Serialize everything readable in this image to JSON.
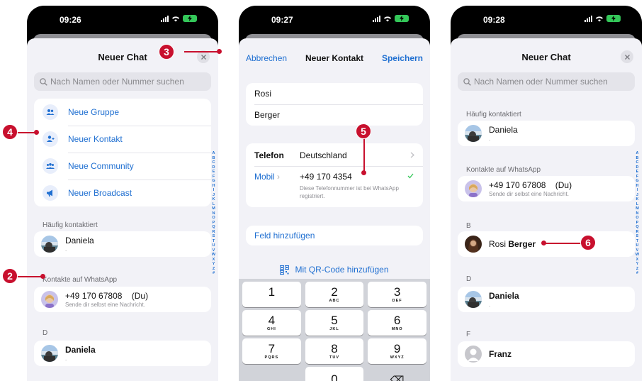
{
  "screen1": {
    "time": "09:26",
    "title": "Neuer Chat",
    "search_placeholder": "Nach Namen oder Nummer suchen",
    "actions": [
      {
        "label": "Neue Gruppe",
        "icon": "group-icon"
      },
      {
        "label": "Neuer Kontakt",
        "icon": "add-contact-icon"
      },
      {
        "label": "Neue Community",
        "icon": "community-icon"
      },
      {
        "label": "Neuer Broadcast",
        "icon": "broadcast-icon"
      }
    ],
    "section_frequent": "Häufig kontaktiert",
    "frequent": [
      {
        "name": "Daniela",
        "sub": "."
      }
    ],
    "section_whatsapp": "Kontakte auf WhatsApp",
    "self_contact": {
      "name": "+49 170 67808",
      "tag": "(Du)",
      "sub": "Sende dir selbst eine Nachricht."
    },
    "section_d": "D",
    "d_contacts": [
      {
        "name": "Daniela",
        "sub": "."
      }
    ]
  },
  "screen2": {
    "time": "09:27",
    "cancel": "Abbrechen",
    "title": "Neuer Kontakt",
    "save": "Speichern",
    "first_name": "Rosi",
    "last_name": "Berger",
    "phone_label": "Telefon",
    "country": "Deutschland",
    "mobile_label": "Mobil",
    "phone_number": "+49  170 4354",
    "registered_note": "Diese Telefonnummer ist bei WhatsApp registriert.",
    "add_field": "Feld hinzufügen",
    "qr_add": "Mit QR-Code hinzufügen",
    "keys": [
      {
        "n": "1",
        "l": ""
      },
      {
        "n": "2",
        "l": "ABC"
      },
      {
        "n": "3",
        "l": "DEF"
      },
      {
        "n": "4",
        "l": "GHI"
      },
      {
        "n": "5",
        "l": "JKL"
      },
      {
        "n": "6",
        "l": "MNO"
      },
      {
        "n": "7",
        "l": "PQRS"
      },
      {
        "n": "8",
        "l": "TUV"
      },
      {
        "n": "9",
        "l": "WXYZ"
      },
      {
        "n": "",
        "l": ""
      },
      {
        "n": "0",
        "l": ""
      },
      {
        "n": "⌫",
        "l": ""
      }
    ]
  },
  "screen3": {
    "time": "09:28",
    "title": "Neuer Chat",
    "search_placeholder": "Nach Namen oder Nummer suchen",
    "section_frequent": "Häufig kontaktiert",
    "frequent": [
      {
        "name": "Daniela",
        "sub": "."
      }
    ],
    "section_whatsapp": "Kontakte auf WhatsApp",
    "self_contact": {
      "name": "+49 170 67808",
      "tag": "(Du)",
      "sub": "Sende dir selbst eine Nachricht."
    },
    "section_b": "B",
    "b_contact": {
      "first": "Rosi",
      "last": "Berger"
    },
    "section_d": "D",
    "d_contact": {
      "name": "Daniela",
      "sub": "."
    },
    "section_f": "F",
    "f_contact": {
      "name": "Franz"
    }
  },
  "index_letters": "ABCDEFGHIJKLMNOPQRSTUVWXYZ#",
  "callouts": {
    "c2": "2",
    "c3": "3",
    "c4": "4",
    "c5": "5",
    "c6": "6"
  },
  "colors": {
    "accent": "#1f6fd1",
    "callout": "#c8102e",
    "battery": "#34c759",
    "check": "#34c759"
  }
}
